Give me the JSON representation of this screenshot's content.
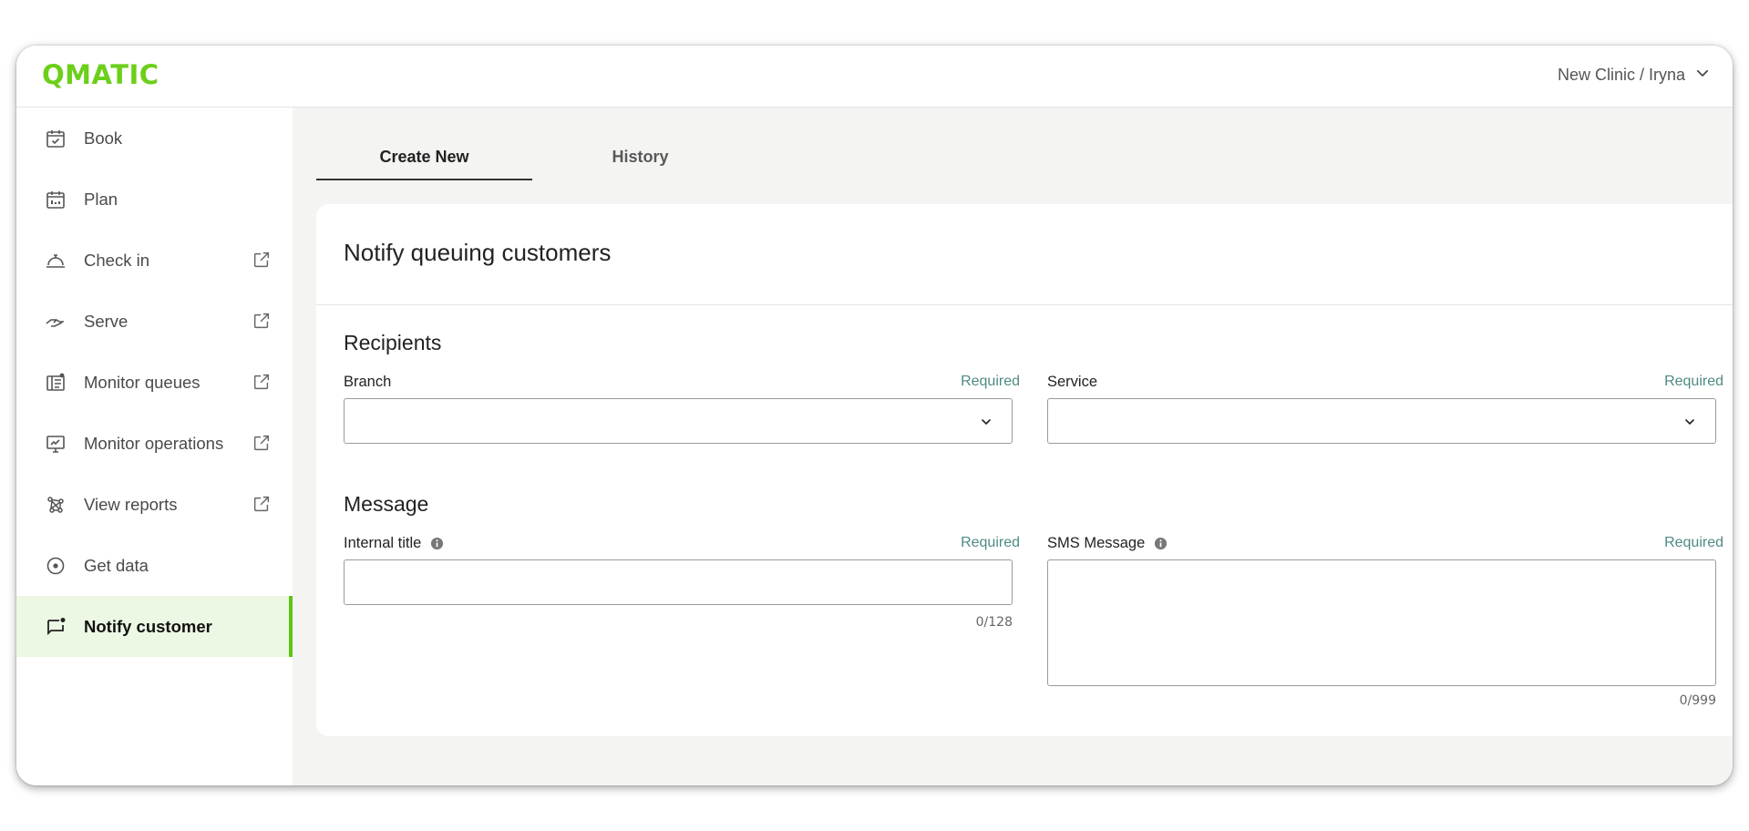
{
  "header": {
    "logo_text": "QMATIC",
    "account_label": "New Clinic / Iryna"
  },
  "sidebar": {
    "items": [
      {
        "label": "Book",
        "icon": "calendar-check-icon",
        "external": false
      },
      {
        "label": "Plan",
        "icon": "calendar-grid-icon",
        "external": false
      },
      {
        "label": "Check in",
        "icon": "service-bell-icon",
        "external": true
      },
      {
        "label": "Serve",
        "icon": "serving-hand-icon",
        "external": true
      },
      {
        "label": "Monitor queues",
        "icon": "queue-board-icon",
        "external": true
      },
      {
        "label": "Monitor operations",
        "icon": "monitor-chart-icon",
        "external": true
      },
      {
        "label": "View reports",
        "icon": "network-nodes-icon",
        "external": true
      },
      {
        "label": "Get data",
        "icon": "target-circle-icon",
        "external": false
      },
      {
        "label": "Notify customer",
        "icon": "chat-notification-icon",
        "external": false,
        "active": true
      }
    ]
  },
  "tabs": [
    {
      "label": "Create New",
      "active": true
    },
    {
      "label": "History",
      "active": false
    }
  ],
  "form": {
    "title": "Notify queuing customers",
    "recipients": {
      "section_title": "Recipients",
      "branch_label": "Branch",
      "branch_required": "Required",
      "branch_value": "",
      "service_label": "Service",
      "service_required": "Required",
      "service_value": ""
    },
    "message": {
      "section_title": "Message",
      "internal_title_label": "Internal title",
      "internal_title_required": "Required",
      "internal_title_value": "",
      "internal_title_counter": "0/128",
      "sms_label": "SMS Message",
      "sms_required": "Required",
      "sms_value": "",
      "sms_counter": "0/999"
    }
  },
  "colors": {
    "brand_green": "#6ccf1a",
    "active_bg": "#ecf8e4",
    "required_text": "#4f8a84"
  }
}
